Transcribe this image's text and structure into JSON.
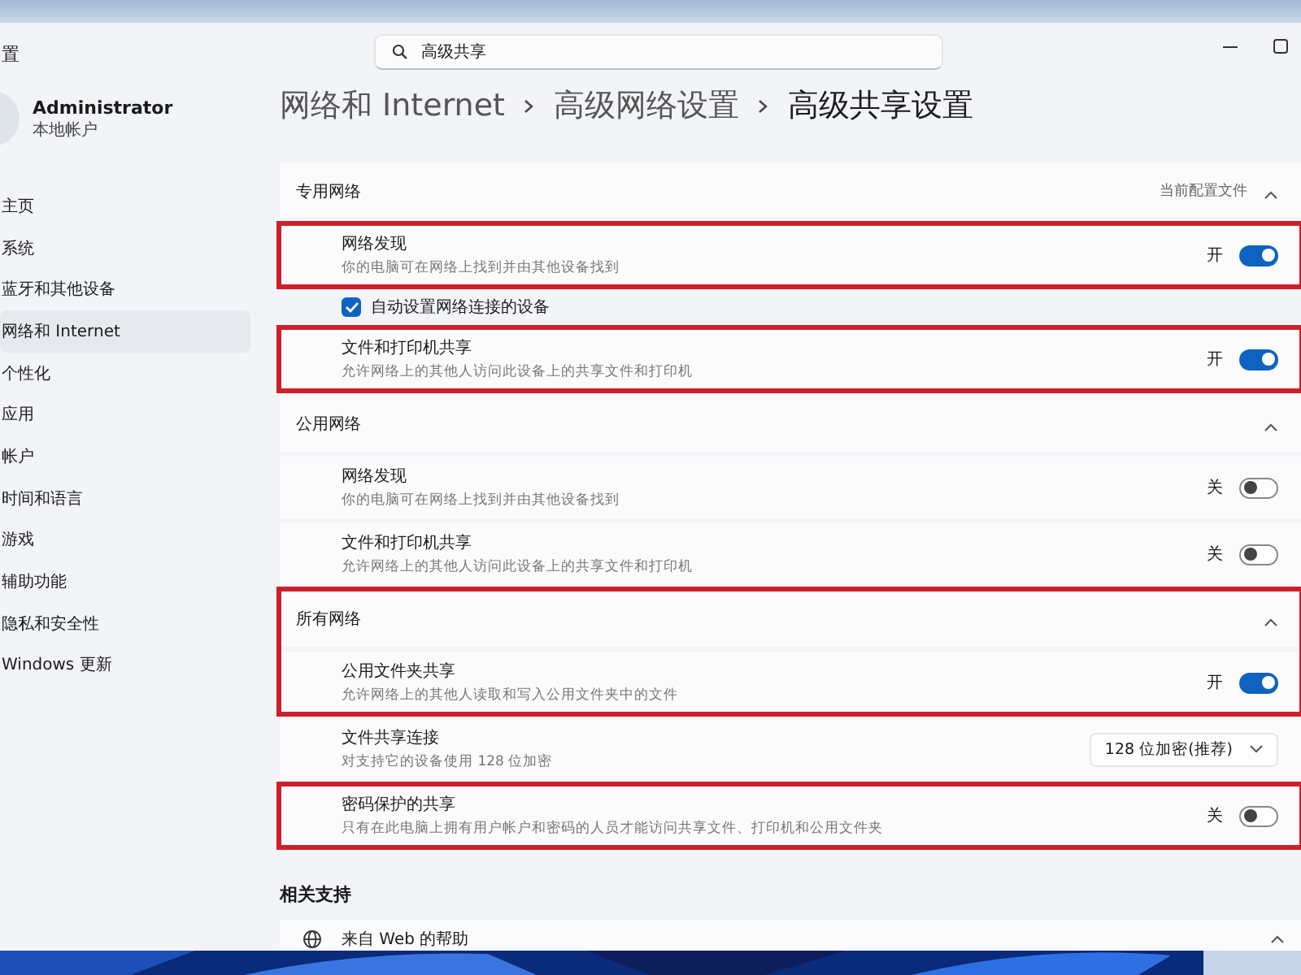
{
  "window": {
    "title": "置",
    "search": {
      "value": "高级共享"
    }
  },
  "user": {
    "name": "Administrator",
    "account": "本地帐户"
  },
  "sidebar": {
    "items": [
      {
        "label": "主页",
        "selected": false
      },
      {
        "label": "系统",
        "selected": false
      },
      {
        "label": "蓝牙和其他设备",
        "selected": false
      },
      {
        "label": "网络和 Internet",
        "selected": true
      },
      {
        "label": "个性化",
        "selected": false
      },
      {
        "label": "应用",
        "selected": false
      },
      {
        "label": "帐户",
        "selected": false
      },
      {
        "label": "时间和语言",
        "selected": false
      },
      {
        "label": "游戏",
        "selected": false
      },
      {
        "label": "辅助功能",
        "selected": false
      },
      {
        "label": "隐私和安全性",
        "selected": false
      },
      {
        "label": "Windows 更新",
        "selected": false
      }
    ]
  },
  "breadcrumb": [
    "网络和 Internet",
    "高级网络设置",
    "高级共享设置"
  ],
  "groups": [
    {
      "highlighted": false,
      "rows": [
        {
          "kind": "header",
          "title": "专用网络",
          "note": "当前配置文件",
          "expanded": true
        }
      ]
    },
    {
      "highlighted": true,
      "rows": [
        {
          "kind": "toggle",
          "title": "网络发现",
          "subtitle": "你的电脑可在网络上找到并由其他设备找到",
          "on": true,
          "state_label": "开"
        }
      ]
    },
    {
      "highlighted": false,
      "rows": [
        {
          "kind": "checkbox",
          "title": "自动设置网络连接的设备",
          "checked": true
        }
      ]
    },
    {
      "highlighted": true,
      "rows": [
        {
          "kind": "toggle",
          "title": "文件和打印机共享",
          "subtitle": "允许网络上的其他人访问此设备上的共享文件和打印机",
          "on": true,
          "state_label": "开"
        }
      ]
    },
    {
      "highlighted": false,
      "rows": [
        {
          "kind": "header",
          "title": "公用网络",
          "expanded": true
        }
      ]
    },
    {
      "highlighted": false,
      "rows": [
        {
          "kind": "toggle",
          "title": "网络发现",
          "subtitle": "你的电脑可在网络上找到并由其他设备找到",
          "on": false,
          "state_label": "关"
        }
      ]
    },
    {
      "highlighted": false,
      "rows": [
        {
          "kind": "toggle",
          "title": "文件和打印机共享",
          "subtitle": "允许网络上的其他人访问此设备上的共享文件和打印机",
          "on": false,
          "state_label": "关"
        }
      ]
    },
    {
      "highlighted": true,
      "rows": [
        {
          "kind": "header",
          "title": "所有网络",
          "expanded": true
        },
        {
          "kind": "toggle",
          "title": "公用文件夹共享",
          "subtitle": "允许网络上的其他人读取和写入公用文件夹中的文件",
          "on": true,
          "state_label": "开"
        }
      ]
    },
    {
      "highlighted": false,
      "rows": [
        {
          "kind": "dropdown",
          "title": "文件共享连接",
          "subtitle": "对支持它的设备使用 128 位加密",
          "value": "128 位加密(推荐)"
        }
      ]
    },
    {
      "highlighted": true,
      "rows": [
        {
          "kind": "toggle",
          "title": "密码保护的共享",
          "subtitle": "只有在此电脑上拥有用户帐户和密码的人员才能访问共享文件、打印机和公用文件夹",
          "on": false,
          "state_label": "关"
        }
      ]
    }
  ],
  "related": {
    "title": "相关支持",
    "items": [
      {
        "label": "来自 Web 的帮助",
        "expanded": true
      }
    ]
  }
}
